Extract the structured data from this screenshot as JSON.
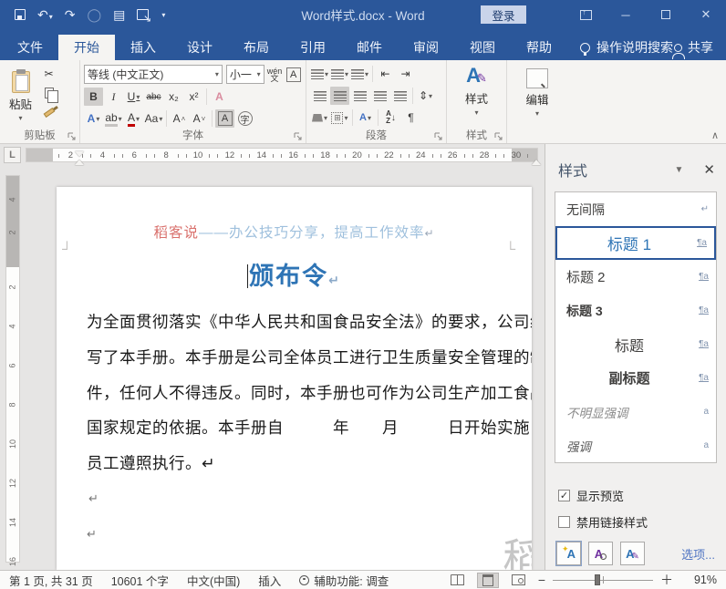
{
  "colors": {
    "accent_blue": "#2b579a",
    "heading_blue": "#2e74b5",
    "header_red": "#d9706c",
    "header_light_blue": "#9fc0dd",
    "ribbon_bg": "#f5f4f2",
    "doc_bg": "#e6e5e4"
  },
  "window": {
    "title": "Word样式.docx - Word",
    "signin_label": "登录"
  },
  "tabs": [
    {
      "label": "文件",
      "cls": "file"
    },
    {
      "label": "开始",
      "cls": "active"
    },
    {
      "label": "插入",
      "cls": ""
    },
    {
      "label": "设计",
      "cls": ""
    },
    {
      "label": "布局",
      "cls": ""
    },
    {
      "label": "引用",
      "cls": ""
    },
    {
      "label": "邮件",
      "cls": ""
    },
    {
      "label": "审阅",
      "cls": ""
    },
    {
      "label": "视图",
      "cls": ""
    },
    {
      "label": "帮助",
      "cls": ""
    }
  ],
  "tellme_label": "操作说明搜索",
  "share_label": "共享",
  "ribbon": {
    "clipboard": {
      "label": "剪贴板",
      "paste": "粘贴"
    },
    "font": {
      "label": "字体",
      "name": "等线 (中文正文)",
      "size": "小一",
      "bold": "B",
      "italic": "I",
      "underline": "U",
      "strike": "abc",
      "sub": "x₂",
      "sup": "x²",
      "effects": "A",
      "highlight": "ab",
      "color": "A",
      "case": "Aa",
      "grow": "A",
      "shrink": "A",
      "shade": "A",
      "enclose": "字",
      "phonetic": "wén 文",
      "border": "A",
      "clear": "A"
    },
    "paragraph": {
      "label": "段落",
      "sort": "A↓Z",
      "marks": "¶"
    },
    "styles": {
      "label": "样式",
      "button": "样式",
      "icon_letter": "A"
    },
    "editing": {
      "button": "编辑"
    }
  },
  "hruler_numbers": [
    "2",
    "4",
    "6",
    "8",
    "10",
    "12",
    "14",
    "16",
    "18",
    "20",
    "22",
    "24",
    "26",
    "28",
    "30"
  ],
  "vruler": {
    "above": [
      "4",
      "2"
    ],
    "below": [
      "2",
      "4",
      "6",
      "8",
      "10",
      "12",
      "14",
      "16"
    ]
  },
  "document": {
    "header_red": "稻客说",
    "header_rest": "——办公技巧分享，提高工作效率",
    "pilcrow": "↵",
    "title": "颁布令",
    "body_lines": [
      {
        "text": "为全面贯彻落实《中华人民共和国食品安全法》的要求，公司编",
        "cls": "first"
      },
      {
        "text": "写了本手册。本手册是公司全体员工进行卫生质量安全管理的制度文",
        "cls": ""
      },
      {
        "text": "件，任何人不得违反。同时，本手册也可作为公司生产加工食品符合",
        "cls": ""
      },
      {
        "text": "国家规定的依据。本手册自　　　年　　月　　　日开始实施，希全体",
        "cls": ""
      },
      {
        "text": "员工遵照执行。↵",
        "cls": "last"
      }
    ],
    "empty_marks": [
      "↵",
      "↵"
    ],
    "watermark_char": "稻"
  },
  "styles_pane": {
    "title": "样式",
    "items": [
      {
        "label": "无间隔",
        "mark": "↵",
        "mark_cls": "",
        "cls": "s-nospace"
      },
      {
        "label": "标题 1",
        "mark": "¶a",
        "mark_cls": "pa",
        "cls": "s-h1"
      },
      {
        "label": "标题 2",
        "mark": "¶a",
        "mark_cls": "pa",
        "cls": "s-h2"
      },
      {
        "label": "标题 3",
        "mark": "¶a",
        "mark_cls": "pa",
        "cls": "s-h3"
      },
      {
        "label": "标题",
        "mark": "¶a",
        "mark_cls": "pa",
        "cls": "s-title"
      },
      {
        "label": "副标题",
        "mark": "¶a",
        "mark_cls": "pa",
        "cls": "s-subtitle"
      },
      {
        "label": "不明显强调",
        "mark": "a",
        "mark_cls": "",
        "cls": "s-subtle"
      },
      {
        "label": "强调",
        "mark": "a",
        "mark_cls": "",
        "cls": "s-emph"
      }
    ],
    "show_preview": {
      "label": "显示预览",
      "checked": true,
      "check_glyph": "✓"
    },
    "disable_linked": {
      "label": "禁用链接样式",
      "checked": false
    },
    "options_label": "选项..."
  },
  "status_bar": {
    "page_info": "第 1 页, 共 31 页",
    "word_count": "10601 个字",
    "language": "中文(中国)",
    "insert_mode": "插入",
    "accessibility": "辅助功能: 调查",
    "zoom_value": "91%"
  }
}
